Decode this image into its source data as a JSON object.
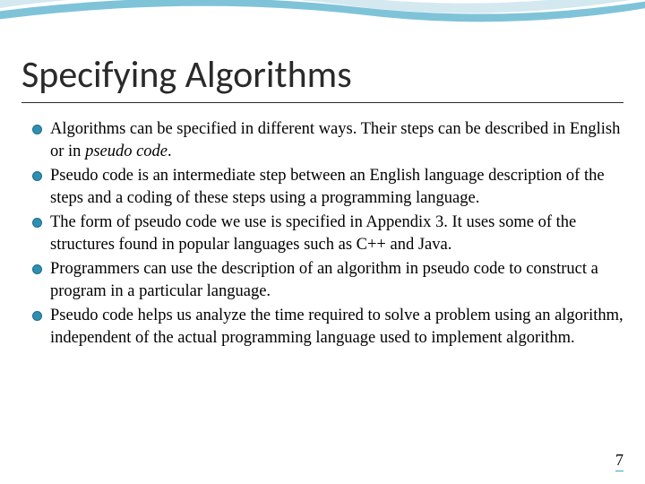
{
  "title": "Specifying Algorithms",
  "bullets": [
    {
      "pre": "Algorithms can be specified in different ways. Their steps can be described in English or in ",
      "italic": "pseudo code",
      "post": "."
    },
    {
      "pre": "Pseudo code is an intermediate step between an English language description of the steps and a coding of these steps using a programming language.",
      "italic": "",
      "post": ""
    },
    {
      "pre": "The form of pseudo code  we use is specified in Appendix 3. It uses some of the structures found in popular languages such as C++ and Java.",
      "italic": "",
      "post": ""
    },
    {
      "pre": "Programmers can use the description of an algorithm in pseudo code to construct a program in a particular language.",
      "italic": "",
      "post": ""
    },
    {
      "pre": "Pseudo code helps us analyze the time required to solve a problem using an algorithm, independent of the actual programming language used to implement algorithm.",
      "italic": "",
      "post": ""
    }
  ],
  "page_number": "7"
}
